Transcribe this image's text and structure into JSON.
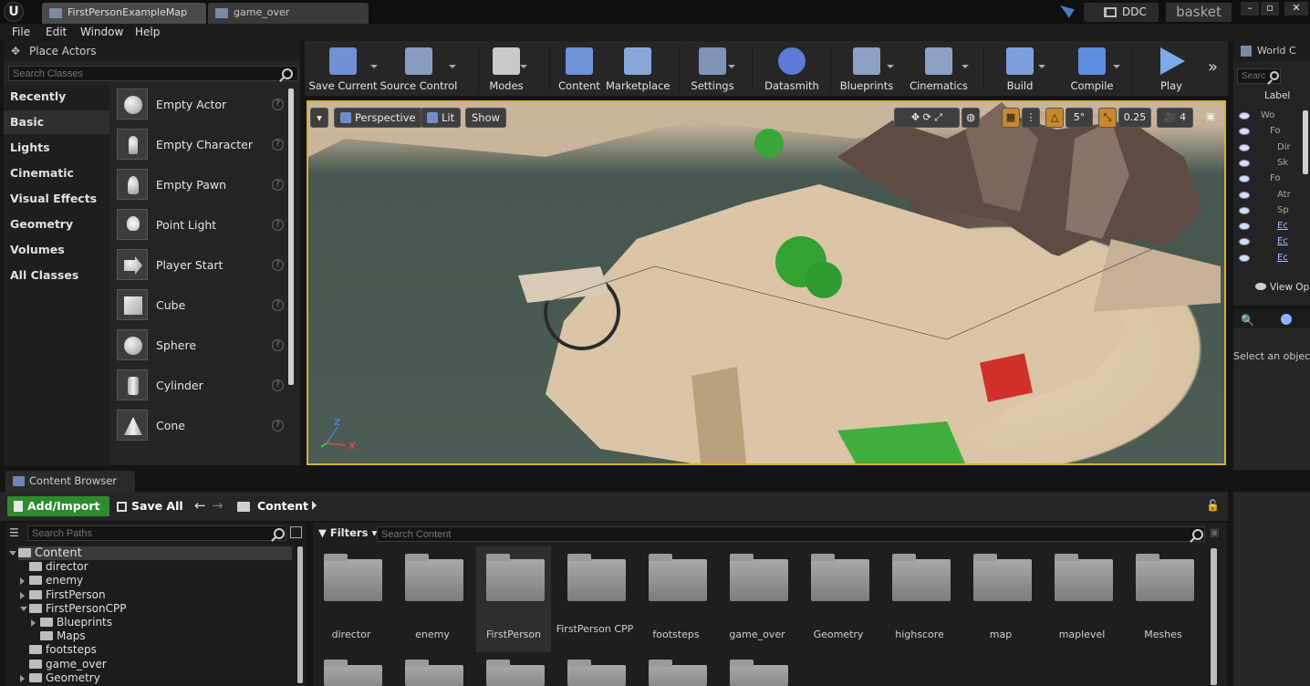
{
  "titlebar": {
    "logo": "U",
    "tabs": [
      {
        "label": "FirstPersonExampleMap",
        "active": true
      },
      {
        "label": "game_over",
        "active": false
      }
    ],
    "ddc_label": "DDC",
    "user_label": "basket",
    "window_controls": [
      "–",
      "▫",
      "✕"
    ]
  },
  "menubar": {
    "items": [
      "File",
      "Edit",
      "Window",
      "Help"
    ]
  },
  "place_actors": {
    "tab_label": "Place Actors",
    "search_placeholder": "Search Classes",
    "categories": [
      "Recently Placed",
      "Basic",
      "Lights",
      "Cinematic",
      "Visual Effects",
      "Geometry",
      "Volumes",
      "All Classes"
    ],
    "selected_category": "Basic",
    "actors": [
      {
        "name": "Empty Actor",
        "icon": "empty"
      },
      {
        "name": "Empty Character",
        "icon": "figure"
      },
      {
        "name": "Empty Pawn",
        "icon": "pawn"
      },
      {
        "name": "Point Light",
        "icon": "light"
      },
      {
        "name": "Player Start",
        "icon": "start"
      },
      {
        "name": "Cube",
        "icon": "cube"
      },
      {
        "name": "Sphere",
        "icon": "sphere"
      },
      {
        "name": "Cylinder",
        "icon": "cyl"
      },
      {
        "name": "Cone",
        "icon": "cone"
      }
    ]
  },
  "toolbar": {
    "buttons": [
      {
        "label": "Save Current",
        "icon": "save-icon",
        "color": "#6f8fd6"
      },
      {
        "label": "Source Control",
        "icon": "source-control-icon",
        "color": "#8a9bc0"
      },
      {
        "label": "Modes",
        "icon": "modes-icon",
        "color": "#c9c9c9"
      },
      {
        "label": "Content",
        "icon": "content-icon",
        "color": "#6f92d8"
      },
      {
        "label": "Marketplace",
        "icon": "marketplace-icon",
        "color": "#8aa6d8"
      },
      {
        "label": "Settings",
        "icon": "settings-icon",
        "color": "#7f92b8"
      },
      {
        "label": "Datasmith",
        "icon": "datasmith-icon",
        "color": "#5d7ad6"
      },
      {
        "label": "Blueprints",
        "icon": "blueprints-icon",
        "color": "#8f9fc5"
      },
      {
        "label": "Cinematics",
        "icon": "cinematics-icon",
        "color": "#8f9fc5"
      },
      {
        "label": "Build",
        "icon": "build-icon",
        "color": "#7f9fdc"
      },
      {
        "label": "Compile",
        "icon": "compile-icon",
        "color": "#5f8ee0"
      },
      {
        "label": "Play",
        "icon": "play-icon",
        "color": "#7faae8"
      }
    ],
    "overflow": "»"
  },
  "viewport": {
    "perspective_label": "Perspective",
    "lit_label": "Lit",
    "show_label": "Show",
    "angle_value": "5°",
    "scale_value": "0.25",
    "camera_speed": "4",
    "axis_z": "Z",
    "axis_x": "X",
    "colors": {
      "border": "#d3b03a",
      "snap_orange": "#c9882a"
    }
  },
  "world_outliner": {
    "tab_label": "World C",
    "search_placeholder": "Searc",
    "column_label": "Label",
    "rows": [
      "Wo",
      "Fo",
      "Dir",
      "Sk",
      "Fo",
      "Atr",
      "Sp",
      "Ec",
      "Ec",
      "Ec"
    ],
    "view_options": "View Op"
  },
  "details": {
    "empty_message": "Select an object"
  },
  "content_browser": {
    "tab_label": "Content Browser",
    "add_import_label": "Add/Import",
    "save_all_label": "Save All",
    "breadcrumb": "Content",
    "search_paths_placeholder": "Search Paths",
    "filters_label": "Filters",
    "search_content_placeholder": "Search Content",
    "tree": [
      {
        "label": "Content",
        "depth": 0,
        "expand": "open",
        "selected": true
      },
      {
        "label": "director",
        "depth": 1,
        "expand": "none"
      },
      {
        "label": "enemy",
        "depth": 1,
        "expand": "closed"
      },
      {
        "label": "FirstPerson",
        "depth": 1,
        "expand": "closed"
      },
      {
        "label": "FirstPersonCPP",
        "depth": 1,
        "expand": "open"
      },
      {
        "label": "Blueprints",
        "depth": 2,
        "expand": "closed"
      },
      {
        "label": "Maps",
        "depth": 2,
        "expand": "none"
      },
      {
        "label": "footsteps",
        "depth": 1,
        "expand": "none"
      },
      {
        "label": "game_over",
        "depth": 1,
        "expand": "none"
      },
      {
        "label": "Geometry",
        "depth": 1,
        "expand": "closed"
      }
    ],
    "folders": [
      "director",
      "enemy",
      "FirstPerson",
      "FirstPerson CPP",
      "footsteps",
      "game_over",
      "Geometry",
      "highscore",
      "map",
      "maplevel",
      "Meshes"
    ],
    "hovered_folder": "FirstPerson",
    "second_row_count": 6,
    "colors": {
      "add_import": "#2e8a2e"
    }
  }
}
